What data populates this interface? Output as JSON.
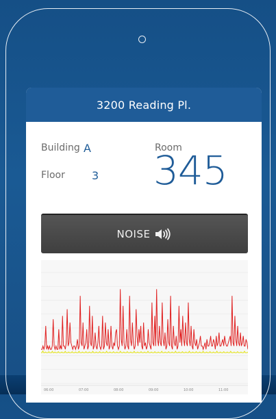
{
  "header": {
    "title": "3200 Reading Pl."
  },
  "location": {
    "building_label": "Building",
    "building_value": "A",
    "floor_label": "Floor",
    "floor_value": "3",
    "room_label": "Room",
    "room_value": "345"
  },
  "noise_button": {
    "label": "NOISE",
    "icon": "speaker-volume-icon"
  },
  "chart_data": {
    "type": "line",
    "x_ticks": [
      "06:00",
      "07:00",
      "08:00",
      "09:00",
      "10:00",
      "11:00"
    ],
    "series": [
      {
        "color": "#e02020",
        "values": [
          2,
          2,
          3,
          2,
          3,
          9,
          2,
          3,
          2,
          3,
          2,
          2,
          3,
          11,
          3,
          2,
          3,
          2,
          2,
          8,
          2,
          3,
          2,
          12,
          3,
          3,
          2,
          4,
          14,
          3,
          4,
          10,
          4,
          3,
          2,
          3,
          3,
          2,
          3,
          5,
          2,
          3,
          18,
          4,
          3,
          10,
          2,
          3,
          4,
          8,
          2,
          3,
          15,
          4,
          3,
          12,
          2,
          3,
          7,
          3,
          2,
          4,
          9,
          3,
          2,
          3,
          12,
          2,
          3,
          10,
          4,
          3,
          8,
          2,
          3,
          9,
          3,
          2,
          4,
          3,
          7,
          8,
          3,
          2,
          3,
          20,
          5,
          3,
          15,
          4,
          2,
          3,
          8,
          3,
          2,
          18,
          5,
          3,
          10,
          4,
          2,
          3,
          14,
          6,
          3,
          8,
          4,
          9,
          3,
          2,
          10,
          3,
          4,
          2,
          3,
          8,
          4,
          3,
          2,
          16,
          4,
          3,
          12,
          3,
          20,
          5,
          3,
          9,
          4,
          3,
          16,
          5,
          3,
          7,
          2,
          3,
          11,
          4,
          3,
          18,
          3,
          2,
          9,
          4,
          3,
          6,
          2,
          3,
          15,
          4,
          8,
          3,
          12,
          5,
          3,
          10,
          4,
          3,
          16,
          5,
          3,
          9,
          3,
          2,
          8,
          4,
          3,
          5,
          2,
          3,
          4,
          6,
          3,
          3,
          2,
          3,
          4,
          2,
          5,
          3,
          3,
          4,
          6,
          3,
          3,
          5,
          4,
          2,
          6,
          3,
          4,
          7,
          3,
          3,
          4,
          5,
          3,
          6,
          4,
          3,
          3,
          4,
          5,
          6,
          3,
          18,
          4,
          3,
          12,
          5,
          3,
          9,
          4,
          3,
          7,
          3,
          4,
          6,
          3,
          3,
          5,
          4,
          2
        ],
        "ylim": [
          0,
          25
        ]
      },
      {
        "color": "#e3e31a",
        "values": [
          1,
          1,
          1.5,
          1,
          1,
          1.2,
          1,
          1,
          1,
          1.3,
          1,
          1,
          1,
          1.4,
          1,
          1,
          1.2,
          1,
          1,
          1,
          1.3,
          1,
          1,
          1,
          1.2,
          1,
          1,
          1,
          1.4,
          1,
          1,
          1,
          1.2,
          1,
          1,
          1,
          1.3,
          1,
          1,
          1,
          1.2,
          1,
          1,
          1,
          1.4,
          1,
          1,
          1,
          1.2,
          1,
          1,
          1,
          1.3,
          1,
          1,
          1,
          1.2,
          1,
          1,
          1,
          1.4,
          1,
          1,
          1,
          1.2,
          1,
          1,
          1,
          1.3,
          1,
          1,
          1,
          1.2,
          1,
          1,
          1,
          1.4,
          1,
          1,
          1,
          1.2,
          1,
          1,
          1,
          1.3,
          1,
          1,
          1,
          1.2,
          1,
          1,
          1,
          1.4,
          1,
          1,
          1,
          1.2,
          1,
          1,
          1,
          1.3,
          1,
          1,
          1,
          1.2,
          1,
          1,
          1,
          1.4,
          1,
          1,
          1,
          1.2,
          1,
          1,
          1,
          1.3,
          1,
          1,
          1,
          1.2,
          1,
          1,
          1,
          1.4,
          1,
          1,
          1,
          1.2,
          1,
          1,
          1,
          1.3,
          1,
          1,
          1,
          1.2,
          1,
          1,
          1,
          1.4,
          1,
          1,
          1,
          1.2,
          1,
          1,
          1,
          1.3,
          1,
          1,
          1,
          1.2,
          1,
          1,
          1,
          1.4,
          1,
          1,
          1,
          1.2,
          1,
          1,
          1,
          1.3,
          1,
          1,
          1,
          1.2,
          1,
          1,
          1,
          1.4,
          1,
          1,
          1,
          1.2,
          1,
          1,
          1,
          1.3,
          1,
          1,
          1,
          1.2,
          1,
          1,
          1,
          1.4,
          1,
          1,
          1,
          1.2,
          1,
          1,
          1,
          1.3,
          1,
          1,
          1,
          1.2,
          1,
          1,
          1,
          1.4,
          1,
          1,
          1,
          1.2,
          1,
          1,
          1,
          1.3,
          1,
          1,
          1,
          1.2,
          1,
          1,
          1,
          1.4,
          1,
          1,
          1,
          1.2,
          1,
          1,
          1,
          1.3,
          1,
          1,
          1,
          1.2,
          1,
          1,
          1,
          1.4,
          1,
          1,
          1,
          1.2
        ],
        "ylim": [
          0,
          25
        ]
      }
    ],
    "grid": true
  }
}
